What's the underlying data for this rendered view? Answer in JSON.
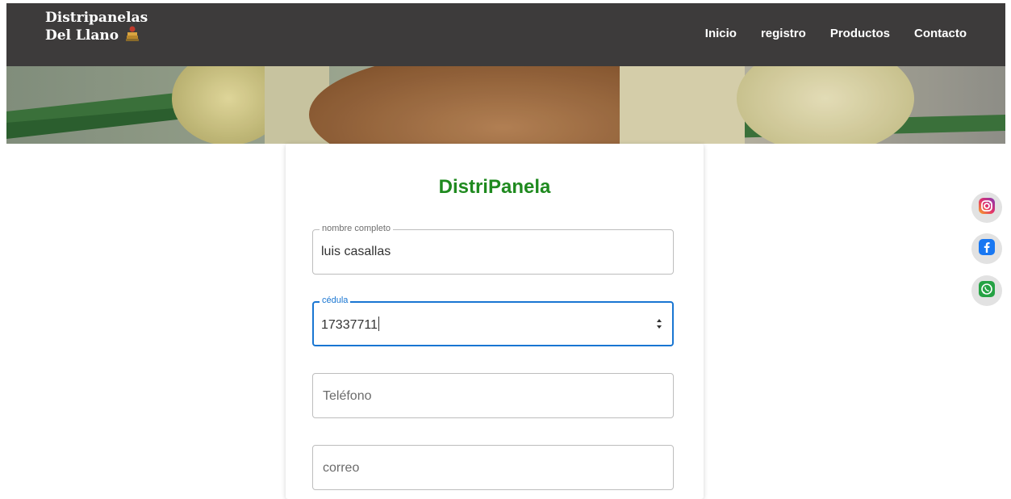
{
  "brand": {
    "line1": "Distripanelas",
    "line2": "Del Llano"
  },
  "nav": {
    "items": [
      "Inicio",
      "registro",
      "Productos",
      "Contacto"
    ]
  },
  "form": {
    "title": "DistriPanela",
    "fields": [
      {
        "label": "nombre completo",
        "value": "luis casallas",
        "placeholder": ""
      },
      {
        "label": "cédula",
        "value": "17337711",
        "placeholder": ""
      },
      {
        "label": "",
        "value": "",
        "placeholder": "Teléfono"
      },
      {
        "label": "",
        "value": "",
        "placeholder": "correo"
      }
    ]
  },
  "social": [
    "instagram-icon",
    "facebook-icon",
    "whatsapp-icon"
  ],
  "colors": {
    "navbar": "#3d3b3b",
    "title_green": "#1f8a1f",
    "focus_blue": "#1976d2"
  }
}
